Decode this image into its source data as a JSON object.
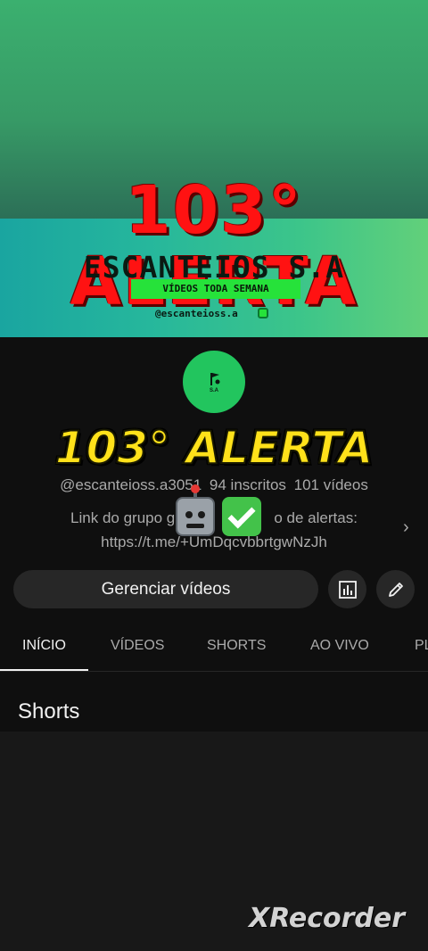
{
  "banner": {
    "title": "103° ALERTA",
    "brand": "ESCANTEIOS S.A",
    "tagline": "VÍDEOS TODA SEMANA",
    "handle": "@escanteioss.a"
  },
  "avatar": {
    "text": "S.A"
  },
  "overlay": {
    "alert_text": "103° ALERTA"
  },
  "channel": {
    "handle": "@escanteioss.a3051",
    "subscribers": "94 inscritos",
    "videos": "101 vídeos",
    "description_line1": "Link do grupo gra",
    "description_line1_end": "o de alertas:",
    "description_line2": "https://t.me/+UmDqcvbbrtgwNzJh"
  },
  "actions": {
    "manage_label": "Gerenciar vídeos"
  },
  "tabs": [
    {
      "label": "INÍCIO",
      "active": true
    },
    {
      "label": "VÍDEOS",
      "active": false
    },
    {
      "label": "SHORTS",
      "active": false
    },
    {
      "label": "AO VIVO",
      "active": false
    },
    {
      "label": "PL",
      "active": false
    }
  ],
  "section": {
    "title": "Shorts"
  },
  "watermark": {
    "text": "XRecorder"
  },
  "icons": {
    "analytics": "bar-chart-icon",
    "edit": "pencil-icon",
    "chevron": "chevron-right-icon",
    "instagram": "instagram-icon"
  }
}
